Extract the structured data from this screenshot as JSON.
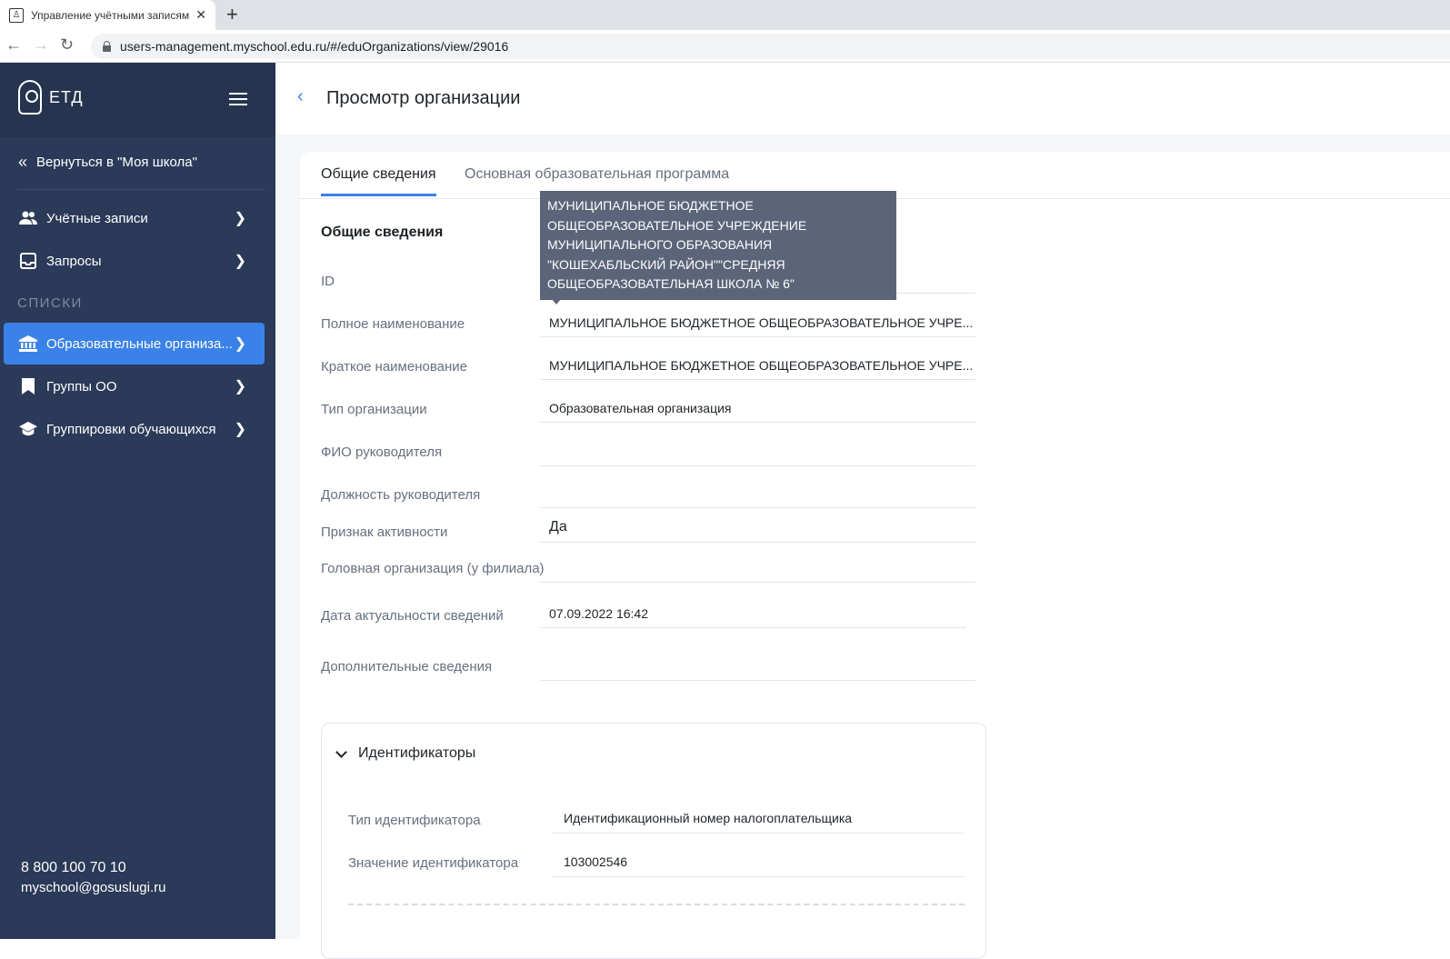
{
  "browser": {
    "tab_title": "Управление учётными записями",
    "new_tab_symbol": "+",
    "close_symbol": "✕",
    "url": "users-management.myschool.edu.ru/#/eduOrganizations/view/29016"
  },
  "sidebar": {
    "logo_text": "ЕТД",
    "back_label": "Вернуться в \"Моя школа\"",
    "items_top": [
      {
        "label": "Учётные записи",
        "icon": "users-icon"
      },
      {
        "label": "Запросы",
        "icon": "inbox-icon"
      }
    ],
    "section_label": "СПИСКИ",
    "items_lists": [
      {
        "label": "Образовательные организа...",
        "icon": "institution-icon",
        "active": true
      },
      {
        "label": "Группы ОО",
        "icon": "bookmark-icon"
      },
      {
        "label": "Группировки обучающихся",
        "icon": "graduation-cap-icon"
      }
    ],
    "phone": "8 800 100 70 10",
    "email": "myschool@gosuslugi.ru"
  },
  "header": {
    "title": "Просмотр организации"
  },
  "tabs": [
    {
      "label": "Общие сведения",
      "active": true
    },
    {
      "label": "Основная образовательная программа",
      "active": false
    }
  ],
  "general": {
    "section_title": "Общие сведения",
    "fields": [
      {
        "label": "ID",
        "value": ""
      },
      {
        "label": "Полное наименование",
        "value": "МУНИЦИПАЛЬНОЕ БЮДЖЕТНОЕ ОБЩЕОБРАЗОВАТЕЛЬНОЕ УЧРЕ..."
      },
      {
        "label": "Краткое наименование",
        "value": "МУНИЦИПАЛЬНОЕ БЮДЖЕТНОЕ ОБЩЕОБРАЗОВАТЕЛЬНОЕ УЧРЕ..."
      },
      {
        "label": "Тип организации",
        "value": "Образовательная организация"
      },
      {
        "label": "ФИО руководителя",
        "value": ""
      },
      {
        "label": "Должность руководителя",
        "value": ""
      },
      {
        "label": "Признак активности",
        "value": "Да"
      },
      {
        "label": "Головная организация (у филиала)",
        "value": ""
      },
      {
        "label": "Дата актуальности сведений",
        "value": "07.09.2022 16:42"
      },
      {
        "label": "Дополнительные сведения",
        "value": ""
      }
    ]
  },
  "tooltip": {
    "lines": [
      "МУНИЦИПАЛЬНОЕ БЮДЖЕТНОЕ",
      "ОБЩЕОБРАЗОВАТЕЛЬНОЕ УЧРЕЖДЕНИЕ",
      "МУНИЦИПАЛЬНОГО ОБРАЗОВАНИЯ",
      "\"КОШЕХАБЛЬСКИЙ РАЙОН\"\"СРЕДНЯЯ",
      "ОБЩЕОБРАЗОВАТЕЛЬНАЯ ШКОЛА № 6\""
    ]
  },
  "identifiers": {
    "title": "Идентификаторы",
    "type_label": "Тип идентификатора",
    "type_value": "Идентификационный номер налогоплательщика",
    "value_label": "Значение идентификатора",
    "value_value": "103002546"
  }
}
